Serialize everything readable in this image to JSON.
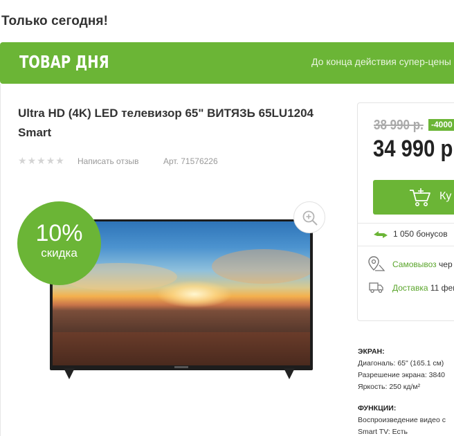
{
  "page": {
    "heading": "Только сегодня!"
  },
  "banner": {
    "title": "ТОВАР ДНЯ",
    "note": "До конца действия супер-цены"
  },
  "product": {
    "title": "Ultra HD (4K) LED телевизор 65\" ВИТЯЗЬ 65LU1204 Smart",
    "rating_stars": 0,
    "review_link": "Написать отзыв",
    "sku": "Арт. 71576226",
    "discount_pct": "10%",
    "discount_word": "скидка"
  },
  "pricing": {
    "old_price": "38 990 р.",
    "save_badge": "-4000",
    "price": "34 990 р.",
    "buy_label": "Ку",
    "bonus": "1 050 бонусов",
    "pickup_link": "Самовывоз",
    "pickup_rest": " чер",
    "delivery_link": "Доставка",
    "delivery_rest": " 11 фев"
  },
  "specs": {
    "screen_head": "ЭКРАН:",
    "diagonal": "Диагональ: 65\" (165.1 см)",
    "resolution": "Разрешение экрана: 3840",
    "brightness": "Яркость: 250 кд/м²",
    "functions_head": "ФУНКЦИИ:",
    "video_playback": "Воспроизведение видео с",
    "smart_tv": "Smart TV: Есть"
  },
  "colors": {
    "accent": "#6bb536",
    "link": "#5aa52b"
  },
  "icons": [
    "zoom-in-icon",
    "cart-icon",
    "bonus-icon",
    "map-pin-icon",
    "truck-icon",
    "star-icon"
  ]
}
